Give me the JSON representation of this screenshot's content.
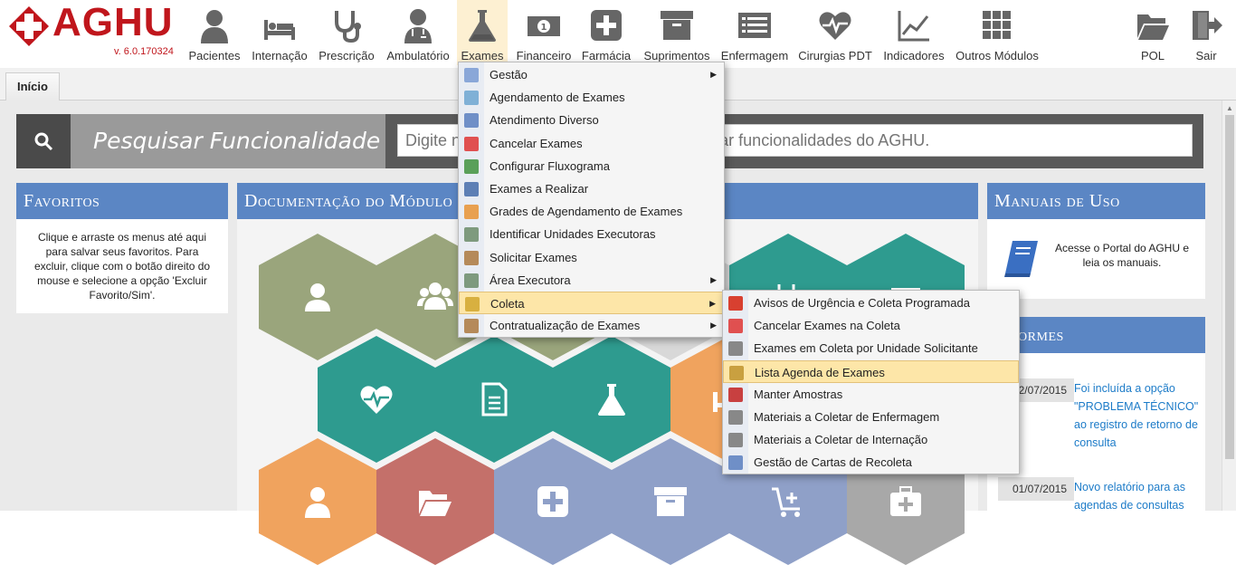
{
  "app": {
    "name": "AGHU",
    "version": "v. 6.0.170324"
  },
  "modules": [
    {
      "label": "Pacientes",
      "icon": "user-icon"
    },
    {
      "label": "Internação",
      "icon": "bed-icon"
    },
    {
      "label": "Prescrição",
      "icon": "stethoscope-icon"
    },
    {
      "label": "Ambulatório",
      "icon": "doctor-icon"
    },
    {
      "label": "Exames",
      "icon": "flask-icon"
    },
    {
      "label": "Financeiro",
      "icon": "money-icon"
    },
    {
      "label": "Farmácia",
      "icon": "plus-icon"
    },
    {
      "label": "Suprimentos",
      "icon": "archive-icon"
    },
    {
      "label": "Enfermagem",
      "icon": "list-icon"
    },
    {
      "label": "Cirurgias PDT",
      "icon": "heartbeat-icon"
    },
    {
      "label": "Indicadores",
      "icon": "chart-icon"
    },
    {
      "label": "Outros Módulos",
      "icon": "grid-icon"
    },
    {
      "label": "POL",
      "icon": "folder-icon"
    },
    {
      "label": "Sair",
      "icon": "exit-icon"
    }
  ],
  "tabs": {
    "home": "Início"
  },
  "search": {
    "label": "Pesquisar Funcionalidade",
    "placeholder": "Digite no mínimo 3 caracteres para pesquisar funcionalidades do AGHU."
  },
  "favorites": {
    "title": "Favoritos",
    "text": "Clique e arraste os menus até aqui para salvar seus favoritos. Para excluir, clique com o botão direito do mouse e selecione a opção 'Excluir Favorito/Sim'."
  },
  "docs": {
    "title": "Documentação do Módulo"
  },
  "manuals": {
    "title": "Manuais de Uso",
    "text": "Acesse o Portal do AGHU e leia os manuais."
  },
  "news": {
    "title": "Informes",
    "items": [
      {
        "date": "02/07/2015",
        "text": "Foi incluída a opção \"PROBLEMA TÉCNICO\" ao registro de retorno de consulta"
      },
      {
        "date": "01/07/2015",
        "text": "Novo relatório para as agendas de consultas"
      }
    ]
  },
  "exames_menu": [
    {
      "label": "Gestão",
      "submenu": true
    },
    {
      "label": "Agendamento de Exames",
      "submenu": false
    },
    {
      "label": "Atendimento Diverso",
      "submenu": false
    },
    {
      "label": "Cancelar Exames",
      "submenu": false
    },
    {
      "label": "Configurar Fluxograma",
      "submenu": false
    },
    {
      "label": "Exames a Realizar",
      "submenu": false
    },
    {
      "label": "Grades de Agendamento de Exames",
      "submenu": false
    },
    {
      "label": "Identificar Unidades Executoras",
      "submenu": false
    },
    {
      "label": "Solicitar Exames",
      "submenu": false
    },
    {
      "label": "Área Executora",
      "submenu": true
    },
    {
      "label": "Coleta",
      "submenu": true
    },
    {
      "label": "Contratualização de Exames",
      "submenu": true
    }
  ],
  "coleta_menu": [
    {
      "label": "Avisos de Urgência e Coleta Programada"
    },
    {
      "label": "Cancelar Exames na Coleta"
    },
    {
      "label": "Exames em Coleta por Unidade Solicitante"
    },
    {
      "label": "Lista Agenda de Exames"
    },
    {
      "label": "Manter Amostras"
    },
    {
      "label": "Materiais a Coletar de Enfermagem"
    },
    {
      "label": "Materiais a Coletar de Internação"
    },
    {
      "label": "Gestão de Cartas de Recoleta"
    }
  ],
  "colors": {
    "brand_red": "#c0161c",
    "panel_blue": "#5b86c4",
    "hex_teal": "#2e9b8f",
    "hex_olive": "#9aa57c",
    "hex_orange": "#f0a35e",
    "hex_rose": "#c4706a",
    "hex_lavender": "#8fa0c8",
    "hex_gray": "#a8a8a8",
    "highlight": "#fde6a8"
  }
}
